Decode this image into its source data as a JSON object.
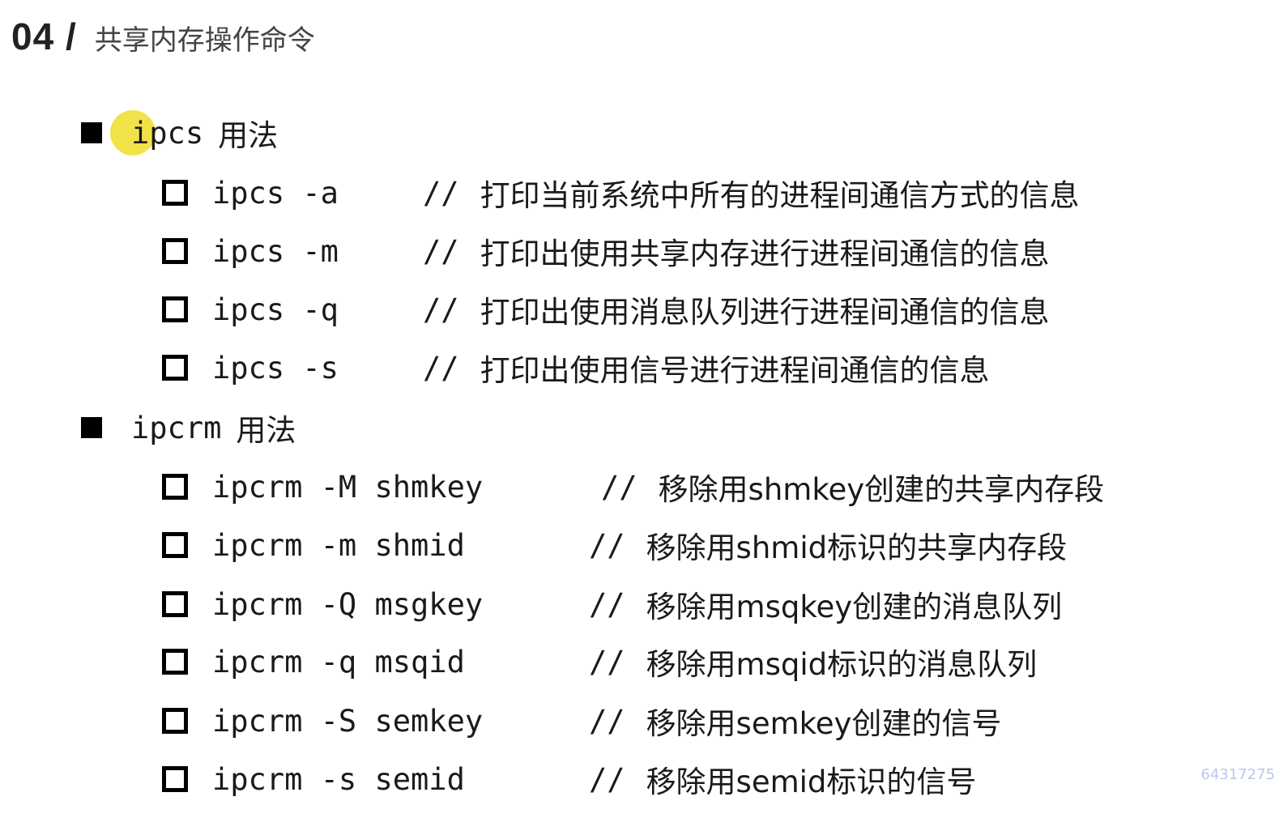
{
  "header": {
    "number": "04 /",
    "title": "共享内存操作命令"
  },
  "sections": [
    {
      "command": "ipcs",
      "suffix": "用法",
      "items": [
        {
          "cmd": "ipcs -a",
          "slashes": "//",
          "comment": "打印当前系统中所有的进程间通信方式的信息"
        },
        {
          "cmd": "ipcs -m",
          "slashes": "//",
          "comment": "打印出使用共享内存进行进程间通信的信息"
        },
        {
          "cmd": "ipcs -q",
          "slashes": "//",
          "comment": "打印出使用消息队列进行进程间通信的信息"
        },
        {
          "cmd": "ipcs -s",
          "slashes": "//",
          "comment": "打印出使用信号进行进程间通信的信息"
        }
      ]
    },
    {
      "command": "ipcrm",
      "suffix": "用法",
      "items": [
        {
          "cmd": "ipcrm -M shmkey",
          "slashes": "//",
          "comment": "移除用shmkey创建的共享内存段"
        },
        {
          "cmd": "ipcrm -m shmid",
          "slashes": "//",
          "comment": "移除用shmid标识的共享内存段"
        },
        {
          "cmd": "ipcrm -Q msgkey",
          "slashes": "//",
          "comment": "移除用msqkey创建的消息队列"
        },
        {
          "cmd": "ipcrm -q msqid",
          "slashes": "//",
          "comment": "移除用msqid标识的消息队列"
        },
        {
          "cmd": "ipcrm -S semkey",
          "slashes": "//",
          "comment": "移除用semkey创建的信号"
        },
        {
          "cmd": "ipcrm -s semid",
          "slashes": "//",
          "comment": "移除用semid标识的信号"
        }
      ]
    }
  ],
  "watermark": "64317275",
  "colors": {
    "cursor_highlight": "#f0e040",
    "text": "#1a1a1a",
    "watermark": "#b7c7ee"
  }
}
